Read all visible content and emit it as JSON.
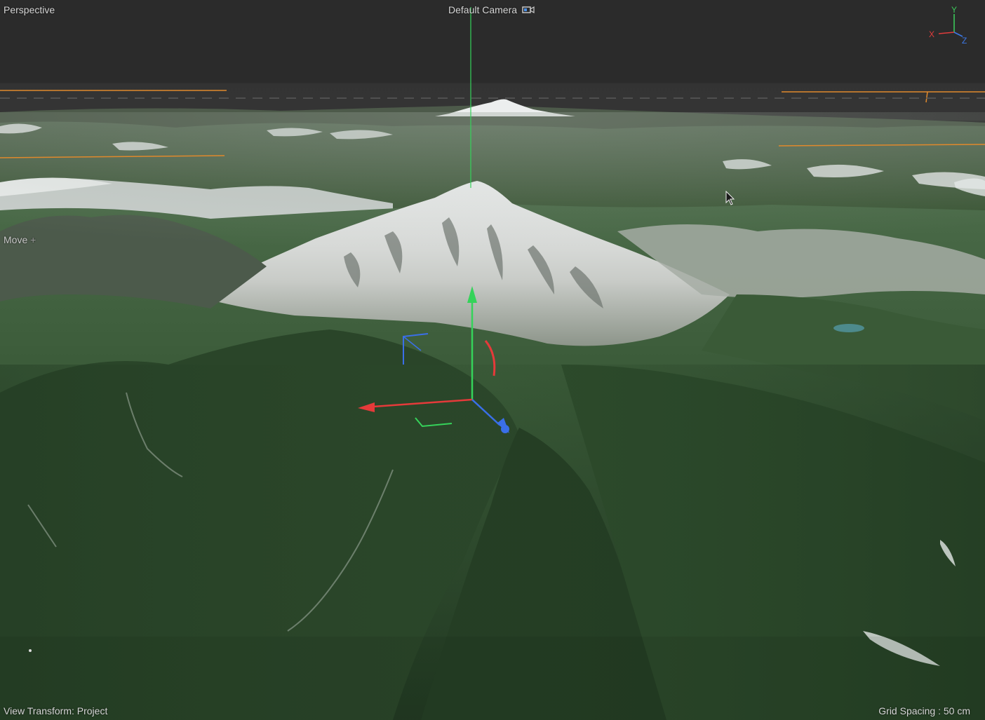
{
  "viewport": {
    "view_mode": "Perspective",
    "camera_name": "Default Camera",
    "move_label": "Move",
    "view_transform": "View Transform: Project",
    "grid_spacing": "Grid Spacing : 50 cm"
  },
  "axis_indicator": {
    "x_label": "X",
    "y_label": "Y",
    "z_label": "Z",
    "x_color": "#e03c3c",
    "y_color": "#3cc85a",
    "z_color": "#3c78e6"
  },
  "gizmo": {
    "tool": "move",
    "x_color": "#e53a3a",
    "y_color": "#35d35a",
    "z_color": "#3a6fe8"
  },
  "icons": {
    "camera": "camera-icon",
    "cursor": "mouse-pointer-icon"
  },
  "colors": {
    "background": "#2b2b2b",
    "text": "#d6d6d6",
    "guide_line": "#e0892c",
    "forest": "#2f4a2e",
    "snow": "#e6e8ea"
  }
}
